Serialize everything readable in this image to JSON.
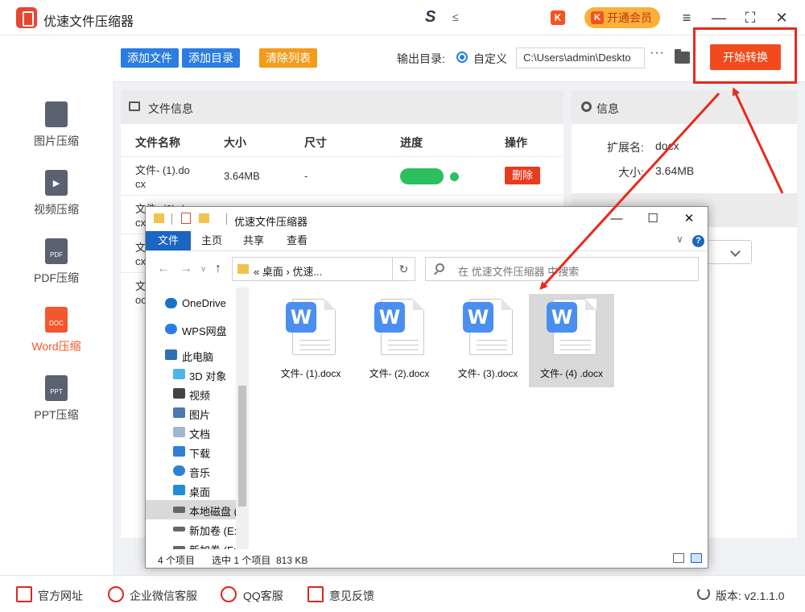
{
  "app": {
    "title": "优速文件压缩器",
    "brand_mark": "S",
    "brand_mark2": "≤",
    "vip_k": "K",
    "vip_label": "开通会员",
    "controls": [
      "≡",
      "—",
      "⛶",
      "✕"
    ]
  },
  "sidebar": {
    "items": [
      {
        "label": "图片压缩",
        "icon": "image-file-icon",
        "badge": "",
        "active": false
      },
      {
        "label": "视频压缩",
        "icon": "video-file-icon",
        "badge": "▶",
        "active": false
      },
      {
        "label": "PDF压缩",
        "icon": "pdf-file-icon",
        "badge": "PDF",
        "active": false
      },
      {
        "label": "Word压缩",
        "icon": "doc-file-icon",
        "badge": "DOC",
        "active": true
      },
      {
        "label": "PPT压缩",
        "icon": "ppt-file-icon",
        "badge": "PPT",
        "active": false
      }
    ]
  },
  "toolbar": {
    "add_file": "添加文件",
    "add_folder": "添加目录",
    "clear_list": "清除列表",
    "output_label": "输出目录:",
    "custom_label": "自定义",
    "output_path": "C:\\Users\\admin\\Deskto",
    "more": "···",
    "start": "开始转换"
  },
  "file_panel": {
    "title": "文件信息",
    "columns": [
      "文件名称",
      "大小",
      "尺寸",
      "进度",
      "操作"
    ],
    "row1": {
      "name_line1": "文件- (1).do",
      "name_line2": "cx",
      "size": "3.64MB",
      "dim": "-",
      "progress": 1.0,
      "action": "删除"
    },
    "row2": {
      "name_line1": "文件- (2).do",
      "name_line2": "cx"
    },
    "row3": {
      "name_line1": "文",
      "name_line2": "cx"
    },
    "row4": {
      "name_line1": "文",
      "name_line2": "oc"
    }
  },
  "info_panel": {
    "title": "信息",
    "ext_label": "扩展名:",
    "ext_value": "docx",
    "size_label": "大小:",
    "size_value": "3.64MB"
  },
  "footer": {
    "website": "官方网址",
    "wechat": "企业微信客服",
    "qq": "QQ客服",
    "feedback": "意见反馈",
    "version": "版本: v2.1.1.0"
  },
  "explorer": {
    "title": "优速文件压缩器",
    "tabs": [
      "文件",
      "主页",
      "共享",
      "查看"
    ],
    "address": "« 桌面 › 优速...",
    "search_placeholder": "在 优速文件压缩器 中搜索",
    "nav": [
      {
        "label": "OneDrive",
        "color": "#1a73c8"
      },
      {
        "label": "WPS网盘",
        "color": "#2b7de9"
      },
      {
        "label": "此电脑",
        "color": "#2f6fb2"
      },
      {
        "label": "3D 对象",
        "color": "#4db6e8"
      },
      {
        "label": "视频",
        "color": "#444"
      },
      {
        "label": "图片",
        "color": "#4a7ab0"
      },
      {
        "label": "文档",
        "color": "#9fb8cf"
      },
      {
        "label": "下载",
        "color": "#2f7fd6"
      },
      {
        "label": "音乐",
        "color": "#2f7fd6"
      },
      {
        "label": "桌面",
        "color": "#1e8ed6"
      },
      {
        "label": "本地磁盘 (",
        "color": "#666"
      },
      {
        "label": "新加卷 (E:)",
        "color": "#666"
      },
      {
        "label": "新加卷 (F:)",
        "color": "#666"
      }
    ],
    "files": [
      {
        "name": "文件- (1).docx",
        "selected": false
      },
      {
        "name": "文件- (2).docx",
        "selected": false
      },
      {
        "name": "文件- (3).docx",
        "selected": false
      },
      {
        "name": "文件- (4) .docx",
        "selected": true
      }
    ],
    "status_count": "4 个项目",
    "status_selected": "选中 1 个项目  813 KB"
  },
  "colors": {
    "accent": "#f34a1d",
    "blue_btn": "#2a7de1",
    "orange_btn": "#f59b1b",
    "annotation_red": "#e8291c"
  }
}
